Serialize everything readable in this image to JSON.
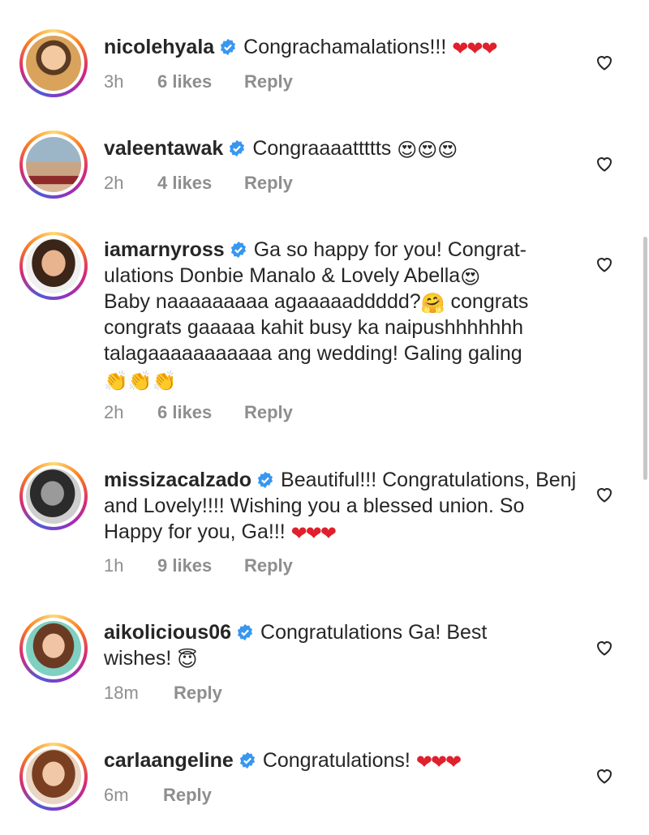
{
  "comments": [
    {
      "username": "nicolehyala",
      "text": "Congrachamalations!!! ",
      "emoji": "❤❤❤",
      "time": "3h",
      "likes": "6 likes",
      "reply": "Reply"
    },
    {
      "username": "valeentawak",
      "text": "Congraaaattttts ",
      "emoji": "😍😍😍",
      "time": "2h",
      "likes": "4 likes",
      "reply": "Reply"
    },
    {
      "username": "iamarnyross",
      "text1": "Ga so happy for you! Congrat-ulations Donbie Manalo & Lovely Abella",
      "emoji1": "😍",
      "text2": "Baby naaaaaaaaa agaaaaaddddd?",
      "emoji2": "🤗",
      "text3": " congrats congrats gaaaaa kahit busy ka naipushhhhhhh talagaaaaaaaaaaa ang wedding! Galing galing",
      "emoji3": "👏👏👏",
      "time": "2h",
      "likes": "6 likes",
      "reply": "Reply"
    },
    {
      "username": "missizacalzado",
      "text": "Beautiful!!! Congratulations, Benj and Lovely!!!! Wishing you a blessed union. So Happy for you, Ga!!! ",
      "emoji": "❤❤❤",
      "time": "1h",
      "likes": "9 likes",
      "reply": "Reply"
    },
    {
      "username": "aikolicious06",
      "text": "Congratulations Ga! Best wishes! ",
      "emoji": "😇",
      "time": "18m",
      "reply": "Reply"
    },
    {
      "username": "carlaangeline",
      "text": "Congratulations! ",
      "emoji": "❤❤❤",
      "time": "6m",
      "reply": "Reply"
    }
  ],
  "colors": {
    "verified": "#3897f0",
    "text": "#262626",
    "meta": "#8e8e8e",
    "heart_emoji": "#e0202c"
  },
  "icons": {
    "verified": "verified-badge-icon",
    "like": "heart-outline-icon"
  }
}
